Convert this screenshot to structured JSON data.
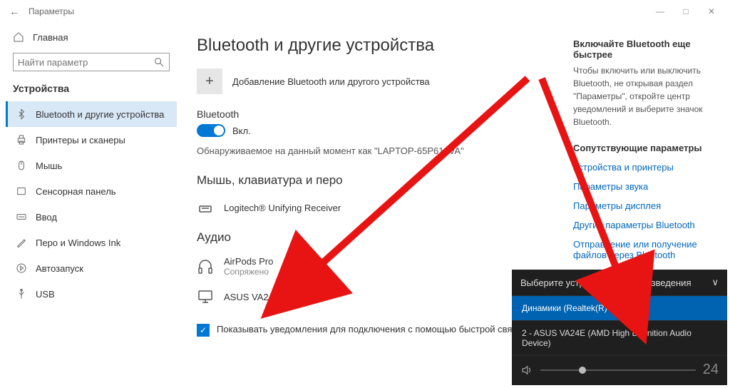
{
  "window": {
    "title": "Параметры"
  },
  "sidebar": {
    "home": "Главная",
    "search_placeholder": "Найти параметр",
    "section": "Устройства",
    "items": [
      {
        "label": "Bluetooth и другие устройства"
      },
      {
        "label": "Принтеры и сканеры"
      },
      {
        "label": "Мышь"
      },
      {
        "label": "Сенсорная панель"
      },
      {
        "label": "Ввод"
      },
      {
        "label": "Перо и Windows Ink"
      },
      {
        "label": "Автозапуск"
      },
      {
        "label": "USB"
      }
    ]
  },
  "content": {
    "heading": "Bluetooth и другие устройства",
    "add_device": "Добавление Bluetooth или другого устройства",
    "bluetooth_label": "Bluetooth",
    "toggle_state": "Вкл.",
    "discoverable": "Обнаруживаемое на данный момент как \"LAPTOP-65P610VA\"",
    "section_mouse": "Мышь, клавиатура и перо",
    "device_logitech": "Logitech® Unifying Receiver",
    "section_audio": "Аудио",
    "device_airpods": "AirPods Pro",
    "device_airpods_status": "Сопряжено",
    "device_asus": "ASUS VA24E",
    "checkbox_label": "Показывать уведомления для подключения с помощью быстрой связи"
  },
  "right": {
    "tip_head": "Включайте Bluetooth еще быстрее",
    "tip_body": "Чтобы включить или выключить Bluetooth, не открывая раздел \"Параметры\", откройте центр уведомлений и выберите значок Bluetooth.",
    "related_head": "Сопутствующие параметры",
    "links": [
      "Устройства и принтеры",
      "Параметры звука",
      "Параметры дисплея",
      "Другие параметры Bluetooth",
      "Отправление или получение файлов через Bluetooth"
    ]
  },
  "flyout": {
    "title": "Выберите устройство воспроизведения",
    "items": [
      "Динамики (Realtek(R) Audio)",
      "2 - ASUS VA24E (AMD High Definition Audio Device)"
    ],
    "volume": "24"
  }
}
